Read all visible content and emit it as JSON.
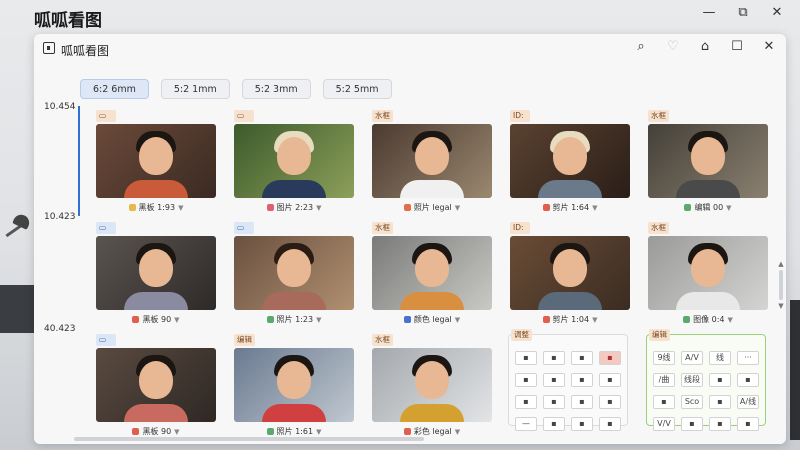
{
  "os": {
    "title": "呱呱看图"
  },
  "window": {
    "title": "呱呱看图"
  },
  "date_chips": [
    "6:2 6mm",
    "5:2 1mm",
    "5:2 3mm",
    "5:2 5mm"
  ],
  "timeline_labels": [
    "10.454",
    "10.423",
    "40.423"
  ],
  "photos": [
    {
      "tag": "",
      "tag_style": "tan",
      "caption": "黑板 1:93",
      "dot": "#e8b84a"
    },
    {
      "tag": "",
      "tag_style": "tan",
      "caption": "图片 2:23",
      "dot": "#e06070"
    },
    {
      "tag": "水框",
      "tag_style": "tan",
      "caption": "照片 legal",
      "dot": "#e0704a"
    },
    {
      "tag": "ID:",
      "tag_style": "tan",
      "caption": "剪片 1:64",
      "dot": "#e06050"
    },
    {
      "tag": "水框",
      "tag_style": "tan",
      "caption": "编辑 00",
      "dot": "#5aaa70"
    },
    {
      "tag": "",
      "tag_style": "blue",
      "caption": "黑板 90",
      "dot": "#e06050"
    },
    {
      "tag": "",
      "tag_style": "blue",
      "caption": "照片 1:23",
      "dot": "#5aaa70"
    },
    {
      "tag": "水框",
      "tag_style": "tan",
      "caption": "颜色 legal",
      "dot": "#4a70d0"
    },
    {
      "tag": "ID:",
      "tag_style": "tan",
      "caption": "剪片 1:04",
      "dot": "#e06050"
    },
    {
      "tag": "水框",
      "tag_style": "tan",
      "caption": "图像 0:4",
      "dot": "#5aaa70"
    },
    {
      "tag": "",
      "tag_style": "blue",
      "caption": "黑板 90",
      "dot": "#e06050"
    },
    {
      "tag": "编辑",
      "tag_style": "tan",
      "caption": "照片 1:61",
      "dot": "#5aaa70"
    },
    {
      "tag": "水框",
      "tag_style": "tan",
      "caption": "彩色 legal",
      "dot": "#e06050"
    }
  ],
  "tool_panel_1": {
    "tag": "调整",
    "tools": [
      "",
      "",
      "",
      "",
      "",
      "",
      "",
      "",
      "",
      "",
      "",
      "",
      "—",
      "",
      "",
      ""
    ]
  },
  "tool_panel_2": {
    "tag": "编辑",
    "tools": [
      "9线",
      "A/V",
      "线",
      "···",
      "/曲",
      "线段",
      "",
      "",
      "",
      "Sco",
      "",
      "A/线",
      "V/V",
      "",
      "",
      ""
    ]
  },
  "colors": {
    "accent": "#2f6fd6",
    "panel_green_border": "#9bd17a",
    "tag_tan": "#f7e2cf",
    "tag_blue": "#dbe7f7"
  }
}
